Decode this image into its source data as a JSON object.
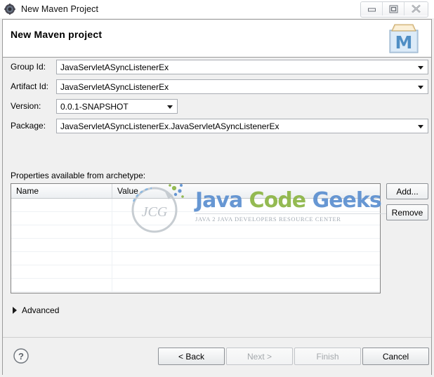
{
  "window": {
    "title": "New Maven Project",
    "icon": "maven-gear-icon",
    "buttons": {
      "minimize": "minimize-icon",
      "maximize": "maximize-icon",
      "close": "close-icon"
    }
  },
  "header": {
    "title": "New Maven project",
    "icon": "maven-folder-icon"
  },
  "form": {
    "fields": [
      {
        "label": "Group Id:",
        "value": "JavaServletASyncListenerEx",
        "type": "combo"
      },
      {
        "label": "Artifact Id:",
        "value": "JavaServletASyncListenerEx",
        "type": "combo"
      },
      {
        "label": "Version:",
        "value": "0.0.1-SNAPSHOT",
        "type": "combo"
      },
      {
        "label": "Package:",
        "value": "JavaServletASyncListenerEx.JavaServletASyncListenerEx",
        "type": "combo"
      }
    ]
  },
  "properties": {
    "label": "Properties available from archetype:",
    "columns": [
      "Name",
      "Value"
    ],
    "rows": [],
    "empty_row_count": 7,
    "buttons": {
      "add": "Add...",
      "remove": "Remove"
    }
  },
  "advanced": {
    "label": "Advanced",
    "expanded": false,
    "arrow_icon": "chevron-right-icon"
  },
  "footer": {
    "help_icon": "help-question-icon",
    "buttons": [
      {
        "label": "< Back",
        "enabled": true
      },
      {
        "label": "Next >",
        "enabled": false
      },
      {
        "label": "Finish",
        "enabled": false
      },
      {
        "label": "Cancel",
        "enabled": true
      }
    ]
  },
  "watermark": {
    "logo_text": "JCG",
    "word1": "Java",
    "word2": "Code",
    "word3": "Geeks",
    "tagline": "JAVA 2 JAVA DEVELOPERS RESOURCE CENTER",
    "colors": {
      "blue": "#5b8fd0",
      "green": "#8cb544",
      "grey": "#b9bfc6"
    }
  }
}
